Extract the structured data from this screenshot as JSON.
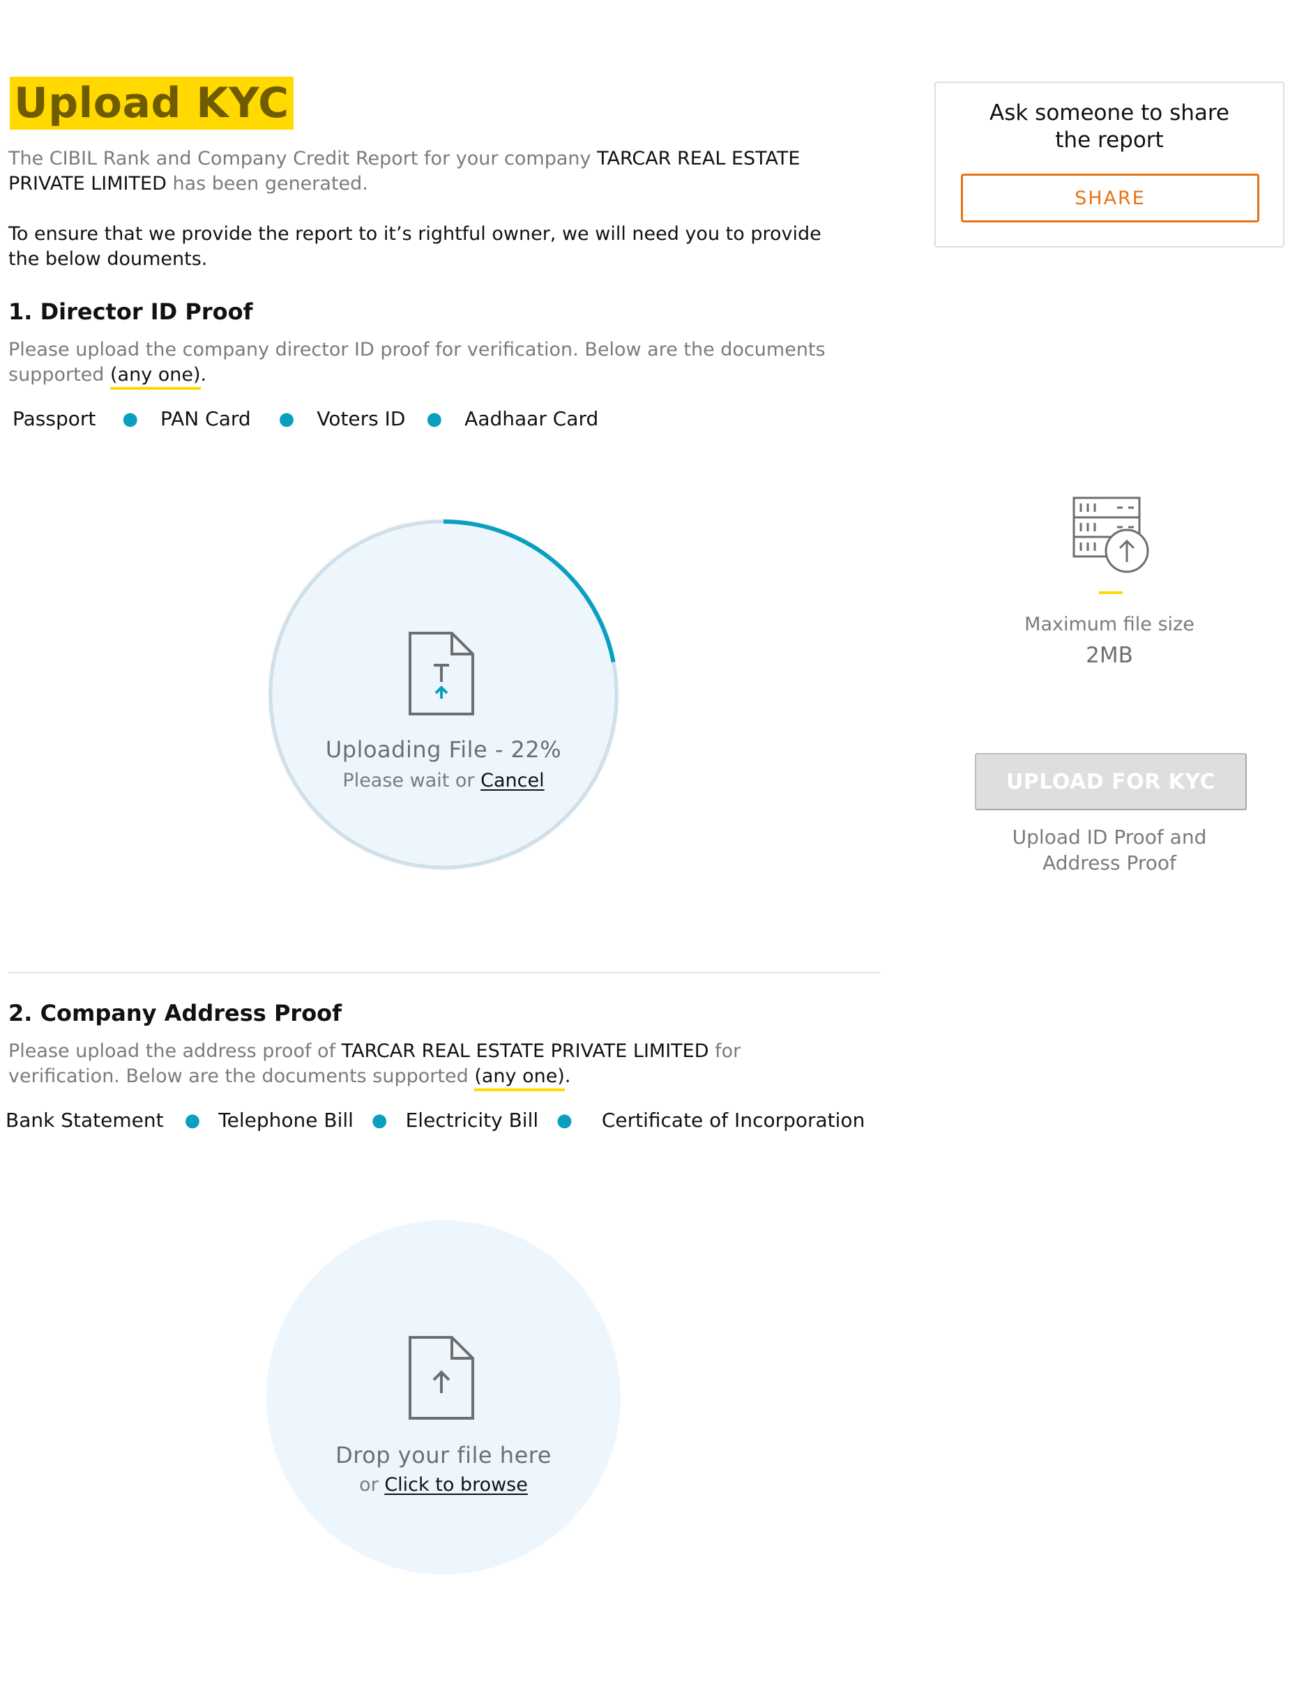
{
  "header": {
    "title": "Upload KYC"
  },
  "intro": {
    "line1_prefix": "The CIBIL Rank and Company Credit Report for your company ",
    "company_name": "TARCAR REAL ESTATE PRIVATE LIMITED",
    "line1_suffix": " has been generated.",
    "line2": "To ensure that we provide the report to it’s rightful owner, we will need you to provide the below douments."
  },
  "section1": {
    "title": "1. Director ID Proof",
    "desc_prefix": "Please upload the company director ID proof for verification. Below are the documents supported ",
    "desc_highlight": "(any one)",
    "desc_suffix": ".",
    "documents": [
      "Passport",
      "PAN Card",
      "Voters ID",
      "Aadhaar Card"
    ],
    "upload": {
      "status_text": "Uploading File - 22%",
      "progress": 0.22,
      "sub_prefix": "Please wait or ",
      "cancel_label": "Cancel"
    }
  },
  "section2": {
    "title": "2. Company Address Proof",
    "desc_prefix": "Please upload the address proof of ",
    "company_name": "TARCAR REAL ESTATE PRIVATE LIMITED",
    "desc_middle": " for verification. Below are the documents supported ",
    "desc_highlight": "(any one)",
    "desc_suffix": ".",
    "documents": [
      "Bank Statement",
      "Telephone Bill",
      "Electricity Bill",
      "Certificate of Incorporation"
    ],
    "upload": {
      "main_text": "Drop your file here",
      "sub_prefix": "or ",
      "browse_label": "Click to browse"
    }
  },
  "sidebar": {
    "share_title": "Ask someone to share the report",
    "share_button": "SHARE",
    "max_size_label": "Maximum file size",
    "max_size_value": "2MB",
    "kyc_button": "UPLOAD FOR KYC",
    "kyc_hint": "Upload ID Proof and Address Proof"
  },
  "colors": {
    "accent_yellow": "#ffd900",
    "progress_teal": "#0a9fbf",
    "share_orange": "#e8730f",
    "circle_bg": "#eef6fd"
  }
}
